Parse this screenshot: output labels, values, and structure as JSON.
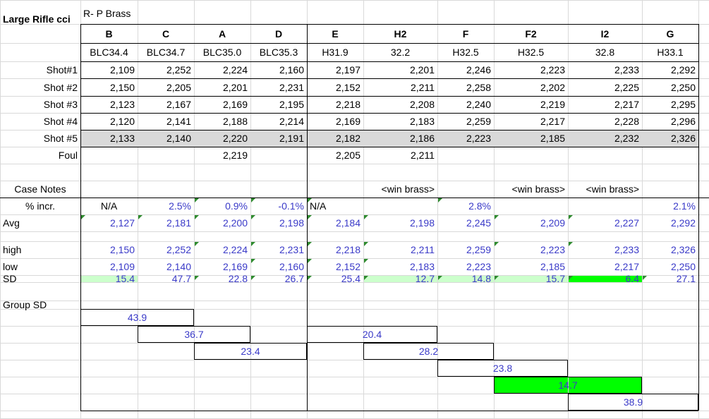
{
  "sheet": {
    "title": "Large Rifle cci",
    "subtitle": "R- P Brass",
    "columns": [
      {
        "letter": "B",
        "charge": "BLC34.4"
      },
      {
        "letter": "C",
        "charge": "BLC34.7"
      },
      {
        "letter": "A",
        "charge": "BLC35.0"
      },
      {
        "letter": "D",
        "charge": "BLC35.3"
      },
      {
        "letter": "E",
        "charge": "H31.9"
      },
      {
        "letter": "H2",
        "charge": "32.2"
      },
      {
        "letter": "F",
        "charge": "H32.5"
      },
      {
        "letter": "F2",
        "charge": "H32.5"
      },
      {
        "letter": "I2",
        "charge": "32.8"
      },
      {
        "letter": "G",
        "charge": "H33.1"
      }
    ],
    "shots": [
      {
        "label": "Shot#1",
        "values": [
          "2,109",
          "2,252",
          "2,224",
          "2,160",
          "2,197",
          "2,201",
          "2,246",
          "2,223",
          "2,233",
          "2,292"
        ]
      },
      {
        "label": "Shot #2",
        "values": [
          "2,150",
          "2,205",
          "2,201",
          "2,231",
          "2,152",
          "2,211",
          "2,258",
          "2,202",
          "2,225",
          "2,250"
        ]
      },
      {
        "label": "Shot #3",
        "values": [
          "2,123",
          "2,167",
          "2,169",
          "2,195",
          "2,218",
          "2,208",
          "2,240",
          "2,219",
          "2,217",
          "2,295"
        ]
      },
      {
        "label": "Shot #4",
        "values": [
          "2,120",
          "2,141",
          "2,188",
          "2,214",
          "2,169",
          "2,183",
          "2,259",
          "2,217",
          "2,228",
          "2,296"
        ]
      },
      {
        "label": "Shot #5",
        "values": [
          "2,133",
          "2,140",
          "2,220",
          "2,191",
          "2,182",
          "2,186",
          "2,223",
          "2,185",
          "2,232",
          "2,326"
        ]
      }
    ],
    "foul": {
      "label": "Foul",
      "values": [
        "",
        "",
        "2,219",
        "",
        "2,205",
        "2,211",
        "",
        "",
        "",
        ""
      ]
    },
    "case_notes": {
      "label": "Case Notes",
      "values": [
        "",
        "",
        "",
        "",
        "",
        "<win brass>",
        "",
        "<win brass>",
        "<win brass>",
        ""
      ]
    },
    "pct_incr": {
      "label": "% incr.",
      "values": [
        "N/A",
        "2.5%",
        "0.9%",
        "-0.1%",
        "N/A",
        "",
        "2.8%",
        "",
        "",
        "2.1%"
      ]
    },
    "avg": {
      "label": "Avg",
      "values": [
        "2,127",
        "2,181",
        "2,200",
        "2,198",
        "2,184",
        "2,198",
        "2,245",
        "2,209",
        "2,227",
        "2,292"
      ]
    },
    "high": {
      "label": "high",
      "values": [
        "2,150",
        "2,252",
        "2,224",
        "2,231",
        "2,218",
        "2,211",
        "2,259",
        "2,223",
        "2,233",
        "2,326"
      ]
    },
    "low": {
      "label": "low",
      "values": [
        "2,109",
        "2,140",
        "2,169",
        "2,160",
        "2,152",
        "2,183",
        "2,223",
        "2,185",
        "2,217",
        "2,250"
      ]
    },
    "sd": {
      "label": "SD",
      "values": [
        "15.4",
        "47.7",
        "22.8",
        "26.7",
        "25.4",
        "12.7",
        "14.8",
        "15.7",
        "6.4",
        "27.1"
      ]
    },
    "group_sd": {
      "label": "Group SD",
      "values": [
        "43.9",
        "36.7",
        "23.4",
        "20.4",
        "28.2",
        "23.8",
        "14.7",
        "38.9"
      ]
    },
    "colors": {
      "light_green": "#ccffcc",
      "bright_green": "#00ff00",
      "grey_fill": "#d9d9d9",
      "value_blue": "#3a3ac8"
    }
  }
}
